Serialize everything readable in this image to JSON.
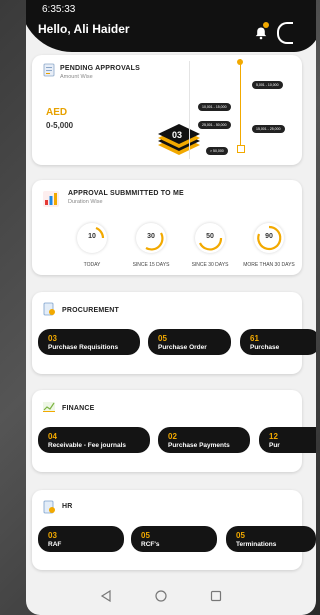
{
  "status": {
    "time": "6:35:33"
  },
  "header": {
    "greeting": "Hello, Ali Haider"
  },
  "pending": {
    "title": "PENDING APPROVALS",
    "subtitle": "Amount Wise",
    "currency": "AED",
    "range": "0-5,000",
    "count": "03",
    "timeline": [
      "5,001 - 10,000",
      "10,001 - 15,000",
      "15,001 - 25,000",
      "25,001 - 50,000",
      "> 50,000"
    ]
  },
  "submitted": {
    "title": "APPROVAL SUBMMITTED TO ME",
    "subtitle": "Duration Wise",
    "dials": [
      {
        "value": "10",
        "label": "TODAY"
      },
      {
        "value": "30",
        "label": "SINCE 15 DAYS"
      },
      {
        "value": "50",
        "label": "SINCE 30 DAYS"
      },
      {
        "value": "90",
        "label": "MORE THAN 30 DAYS"
      }
    ]
  },
  "procurement": {
    "title": "PROCUREMENT",
    "items": [
      {
        "count": "03",
        "label": "Purchase Requisitions"
      },
      {
        "count": "05",
        "label": "Purchase Order"
      },
      {
        "count": "61",
        "label": "Purchase"
      }
    ]
  },
  "finance": {
    "title": "FINANCE",
    "items": [
      {
        "count": "04",
        "label": "Receivable - Fee journals"
      },
      {
        "count": "02",
        "label": "Purchase Payments"
      },
      {
        "count": "12",
        "label": "Pur"
      }
    ]
  },
  "hr": {
    "title": "HR",
    "items": [
      {
        "count": "03",
        "label": "RAF"
      },
      {
        "count": "05",
        "label": "RCF's"
      },
      {
        "count": "05",
        "label": "Terminations"
      }
    ]
  },
  "colors": {
    "accent": "#f2a900",
    "dark": "#141414"
  }
}
